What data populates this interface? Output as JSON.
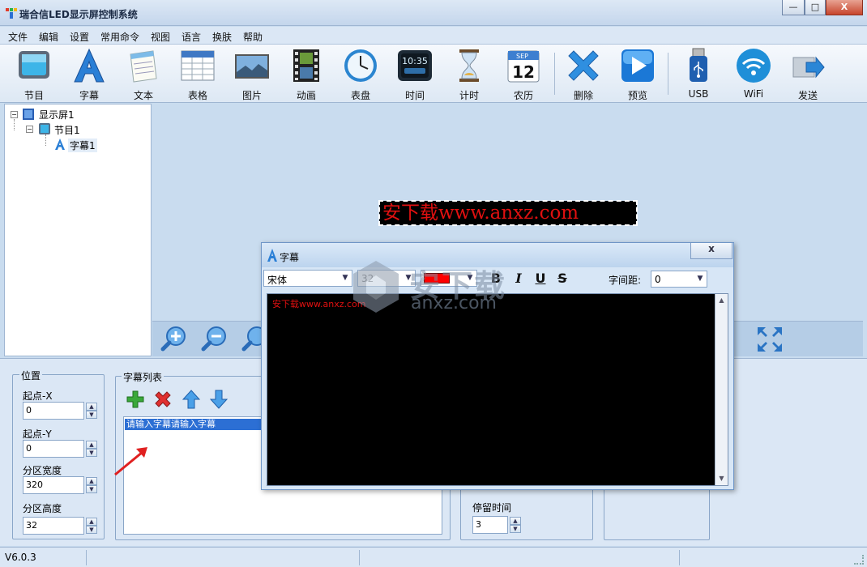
{
  "window": {
    "title": "瑞合信LED显示屏控制系统",
    "controls": {
      "minimize": "—",
      "maximize": "□",
      "close": "X"
    }
  },
  "menu": [
    "文件",
    "编辑",
    "设置",
    "常用命令",
    "视图",
    "语言",
    "换肤",
    "帮助"
  ],
  "toolbar": [
    {
      "label": "节目",
      "icon": "program-icon"
    },
    {
      "label": "字幕",
      "icon": "subtitle-icon"
    },
    {
      "label": "文本",
      "icon": "text-notepad-icon"
    },
    {
      "label": "表格",
      "icon": "table-icon"
    },
    {
      "label": "图片",
      "icon": "picture-icon"
    },
    {
      "label": "动画",
      "icon": "film-icon"
    },
    {
      "label": "表盘",
      "icon": "clock-dial-icon"
    },
    {
      "label": "时间",
      "icon": "digital-clock-icon"
    },
    {
      "label": "计时",
      "icon": "hourglass-icon"
    },
    {
      "label": "农历",
      "icon": "calendar-icon"
    },
    {
      "label": "删除",
      "icon": "delete-x-icon"
    },
    {
      "label": "预览",
      "icon": "play-preview-icon"
    },
    {
      "label": "USB",
      "icon": "usb-drive-icon"
    },
    {
      "label": "WiFi",
      "icon": "wifi-icon"
    },
    {
      "label": "发送",
      "icon": "send-icon"
    }
  ],
  "calendar_icon": {
    "month": "SEP",
    "day": "12"
  },
  "digital_clock_icon": {
    "time": "10:35"
  },
  "tree": {
    "screen": "显示屏1",
    "program": "节目1",
    "subtitle": "字幕1"
  },
  "canvas": {
    "led_text": "安下载www.anxz.com"
  },
  "position_panel": {
    "title": "位置",
    "start_x_label": "起点-X",
    "start_x": "0",
    "start_y_label": "起点-Y",
    "start_y": "0",
    "width_label": "分区宽度",
    "width": "320",
    "height_label": "分区高度",
    "height": "32"
  },
  "subtitle_list": {
    "title": "字幕列表",
    "items": [
      "请输入字幕请输入字幕"
    ]
  },
  "stay_time": {
    "label": "停留时间",
    "value": "3"
  },
  "dialog": {
    "title": "字幕",
    "close": "x",
    "font": "宋体",
    "size": "32",
    "color": "#ff0000",
    "bold": "B",
    "italic": "I",
    "underline": "U",
    "strike": "S",
    "spacing_label": "字间距:",
    "spacing": "0",
    "content": "安下载www.anxz.com"
  },
  "watermark": {
    "cn": "安下载",
    "en": "anxz.com"
  },
  "status": {
    "version": "V6.0.3"
  }
}
